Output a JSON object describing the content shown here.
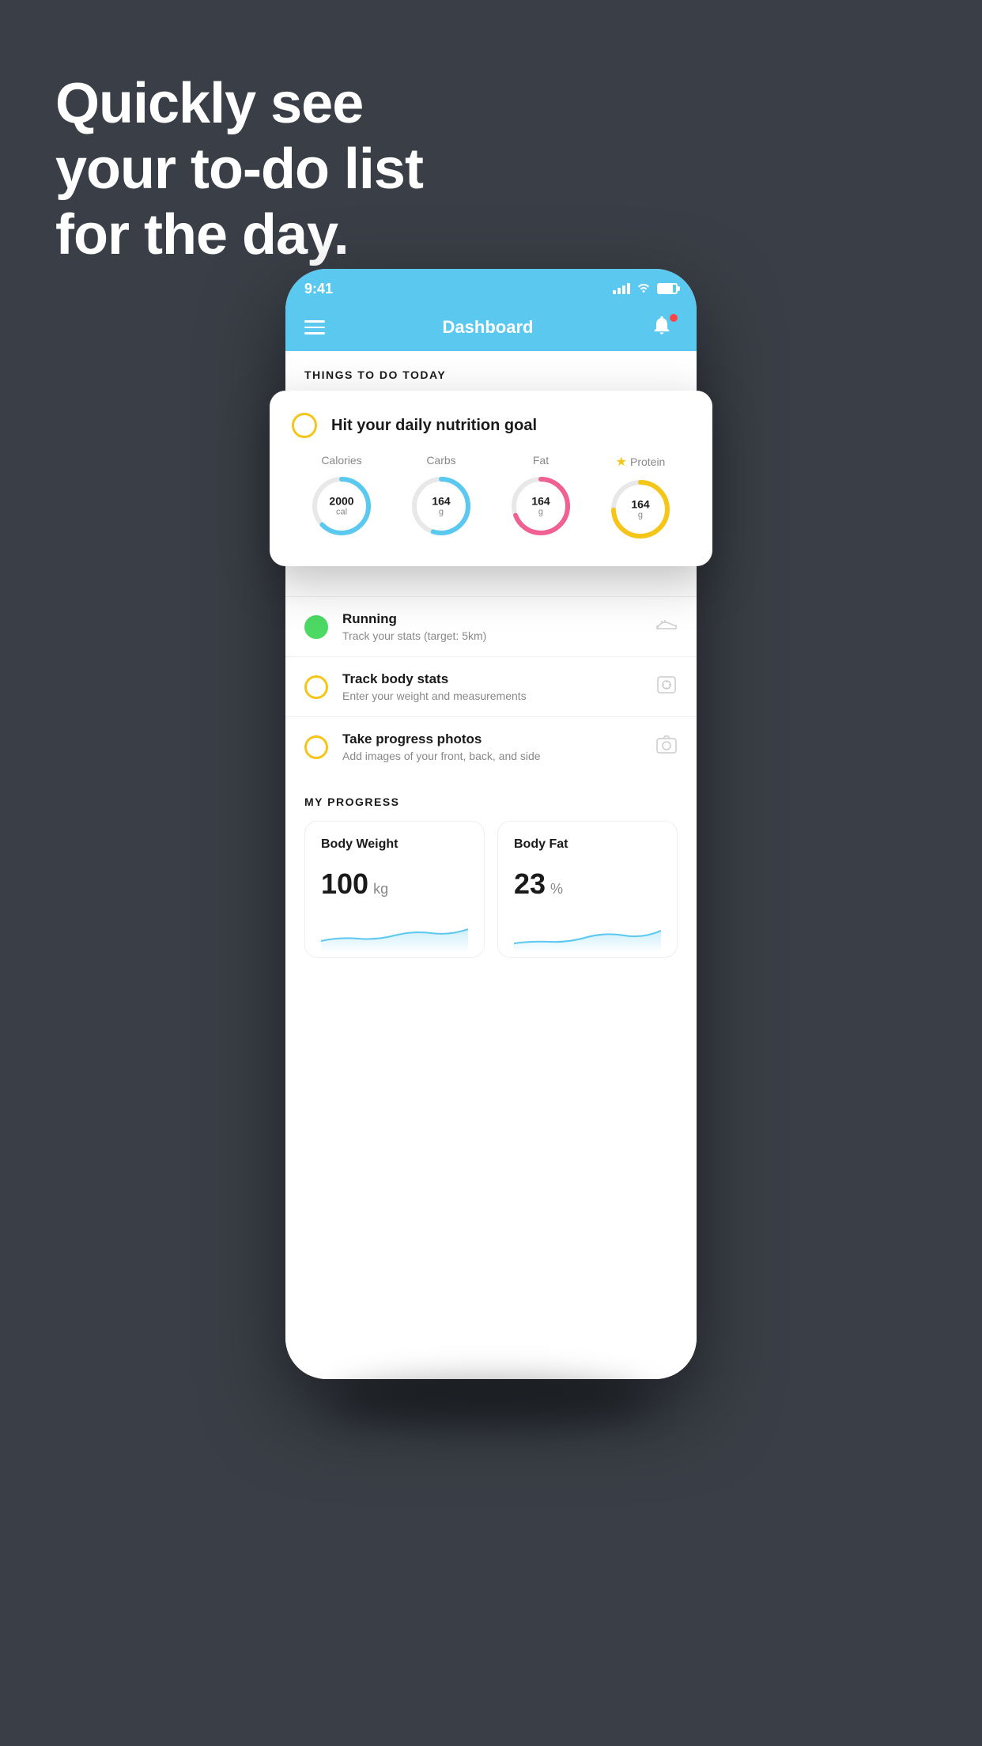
{
  "background_color": "#3a3f47",
  "headline": {
    "line1": "Quickly see",
    "line2": "your to-do list",
    "line3": "for the day."
  },
  "phone": {
    "status_bar": {
      "time": "9:41",
      "signal_label": "signal",
      "wifi_label": "wifi",
      "battery_label": "battery"
    },
    "nav_bar": {
      "title": "Dashboard",
      "menu_label": "menu",
      "bell_label": "notifications"
    },
    "section_title": "THINGS TO DO TODAY",
    "floating_card": {
      "radio_color": "#f5c518",
      "title": "Hit your daily nutrition goal",
      "nutrition": [
        {
          "label": "Calories",
          "value": "2000",
          "unit": "cal",
          "color": "#5bc8f0",
          "percent": 65
        },
        {
          "label": "Carbs",
          "value": "164",
          "unit": "g",
          "color": "#5bc8f0",
          "percent": 55
        },
        {
          "label": "Fat",
          "value": "164",
          "unit": "g",
          "color": "#f06090",
          "percent": 70
        },
        {
          "label": "Protein",
          "value": "164",
          "unit": "g",
          "color": "#f5c518",
          "percent": 75,
          "star": true
        }
      ]
    },
    "todo_items": [
      {
        "id": "running",
        "title": "Running",
        "subtitle": "Track your stats (target: 5km)",
        "circle_color": "green",
        "icon": "shoe"
      },
      {
        "id": "body-stats",
        "title": "Track body stats",
        "subtitle": "Enter your weight and measurements",
        "circle_color": "yellow",
        "icon": "scale"
      },
      {
        "id": "progress-photos",
        "title": "Take progress photos",
        "subtitle": "Add images of your front, back, and side",
        "circle_color": "yellow",
        "icon": "photo"
      }
    ],
    "progress_section": {
      "title": "MY PROGRESS",
      "cards": [
        {
          "title": "Body Weight",
          "value": "100",
          "unit": "kg"
        },
        {
          "title": "Body Fat",
          "value": "23",
          "unit": "%"
        }
      ]
    }
  }
}
